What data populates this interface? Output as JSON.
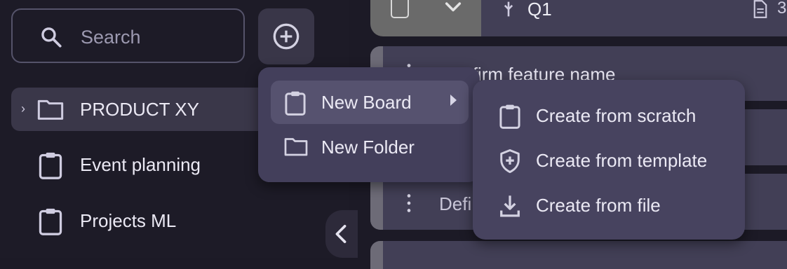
{
  "sidebar": {
    "search": {
      "placeholder": "Search"
    },
    "items": [
      {
        "label": "PRODUCT XY",
        "expanded": false
      },
      {
        "label": "Event planning"
      },
      {
        "label": "Projects ML"
      }
    ]
  },
  "board": {
    "header": {
      "group": "Q1",
      "count_prefix": "3"
    },
    "rows": [
      {
        "text": "Confirm feature name"
      },
      {
        "text": "Defi"
      }
    ]
  },
  "new_menu": {
    "items": [
      {
        "label": "New Board",
        "icon": "clipboard-icon",
        "has_submenu": true
      },
      {
        "label": "New Folder",
        "icon": "folder-icon"
      }
    ]
  },
  "board_submenu": {
    "items": [
      {
        "label": "Create from scratch",
        "icon": "clipboard-icon"
      },
      {
        "label": "Create from template",
        "icon": "shield-plus-icon"
      },
      {
        "label": "Create from file",
        "icon": "download-icon"
      }
    ]
  },
  "colors": {
    "background": "#1c1a26",
    "menu": "#433f5b",
    "accent_surface": "#423f56"
  }
}
